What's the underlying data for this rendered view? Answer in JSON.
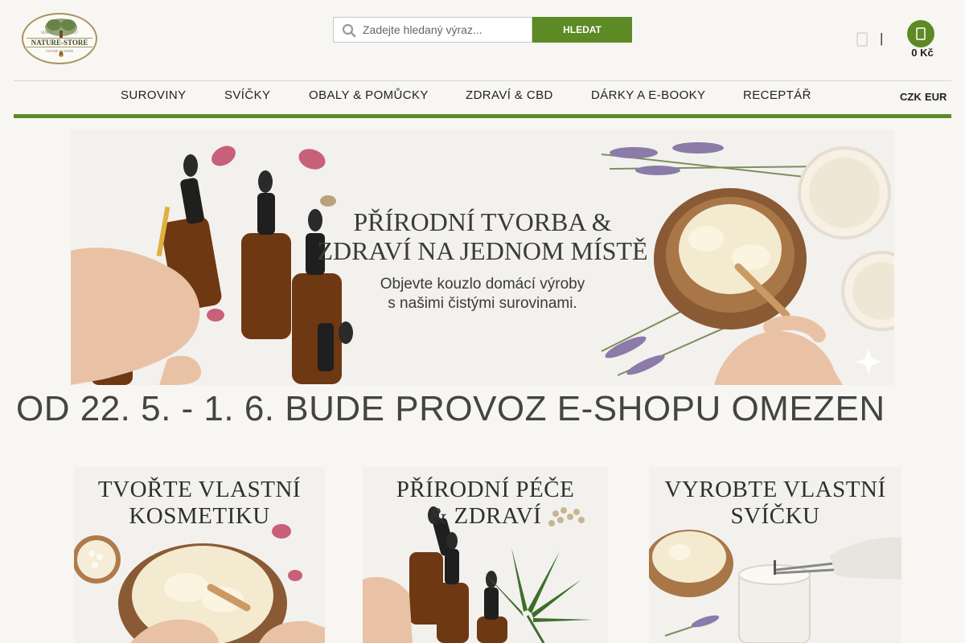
{
  "logo": {
    "name": "NATURE-STORE",
    "since": "SINCE",
    "year": "2017",
    "tagline": "NATURE IN STORE"
  },
  "search": {
    "placeholder": "Zadejte hledaný výraz...",
    "button_label": "HLEDAT"
  },
  "header": {
    "divider": "|",
    "cart_total": "0 Kč"
  },
  "nav": {
    "items": [
      {
        "label": "SUROVINY"
      },
      {
        "label": "SVÍČKY"
      },
      {
        "label": "OBALY & POMŮCKY"
      },
      {
        "label": "ZDRAVÍ & CBD"
      },
      {
        "label": "DÁRKY A E-BOOKY"
      },
      {
        "label": "RECEPTÁŘ"
      }
    ],
    "currencies": [
      "CZK",
      "EUR"
    ]
  },
  "hero": {
    "title": "PŘÍRODNÍ TVORBA &\nZDRAVÍ NA JEDNOM MÍSTĚ",
    "subtitle": "Objevte kouzlo domácí výroby\ns našimi čistými surovinami."
  },
  "notice": "OD 22. 5. - 1. 6. BUDE PROVOZ E-SHOPU OMEZEN",
  "cards": [
    {
      "title": "TVOŘTE VLASTNÍ\nKOSMETIKU"
    },
    {
      "title": "PŘÍRODNÍ PÉČE\n& ZDRAVÍ"
    },
    {
      "title": "VYROBTE VLASTNÍ\nSVÍČKU"
    }
  ],
  "colors": {
    "accent": "#5d8a24",
    "background": "#f8f6f2",
    "text": "#333333"
  },
  "icons": {
    "search": "magnifier",
    "user": "user-icon",
    "cart": "shopping-cart"
  }
}
